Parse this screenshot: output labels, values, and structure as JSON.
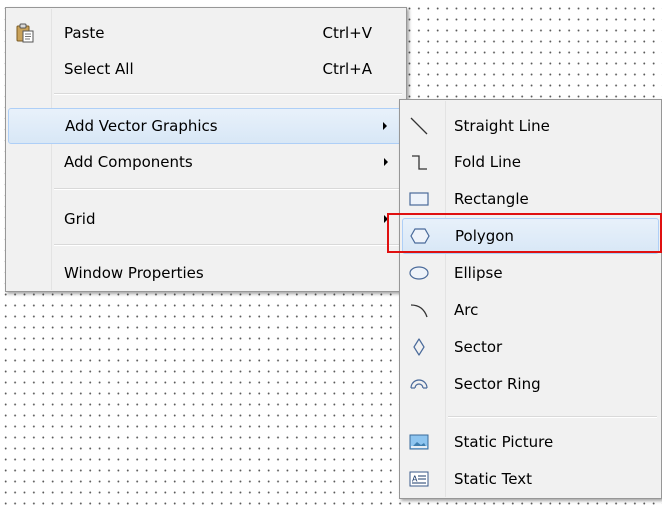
{
  "main_menu": {
    "paste": {
      "label": "Paste",
      "shortcut": "Ctrl+V",
      "icon": "paste-icon"
    },
    "select_all": {
      "label": "Select All",
      "shortcut": "Ctrl+A"
    },
    "add_vector_graphics": {
      "label": "Add Vector Graphics",
      "highlighted": true
    },
    "add_components": {
      "label": "Add Components"
    },
    "grid": {
      "label": "Grid"
    },
    "window_properties": {
      "label": "Window Properties"
    }
  },
  "sub_menu": {
    "straight_line": {
      "label": "Straight Line",
      "icon": "straight-line-icon"
    },
    "fold_line": {
      "label": "Fold Line",
      "icon": "fold-line-icon"
    },
    "rectangle": {
      "label": "Rectangle",
      "icon": "rectangle-icon"
    },
    "polygon": {
      "label": "Polygon",
      "icon": "polygon-icon",
      "highlighted": true
    },
    "ellipse": {
      "label": "Ellipse",
      "icon": "ellipse-icon"
    },
    "arc": {
      "label": "Arc",
      "icon": "arc-icon"
    },
    "sector": {
      "label": "Sector",
      "icon": "sector-icon"
    },
    "sector_ring": {
      "label": "Sector Ring",
      "icon": "sector-ring-icon"
    },
    "static_picture": {
      "label": "Static Picture",
      "icon": "static-picture-icon"
    },
    "static_text": {
      "label": "Static Text",
      "icon": "static-text-icon"
    }
  },
  "colors": {
    "highlight_border": "#aecff7",
    "annotation_box": "#e01010",
    "menu_background": "#f1f1f1"
  }
}
